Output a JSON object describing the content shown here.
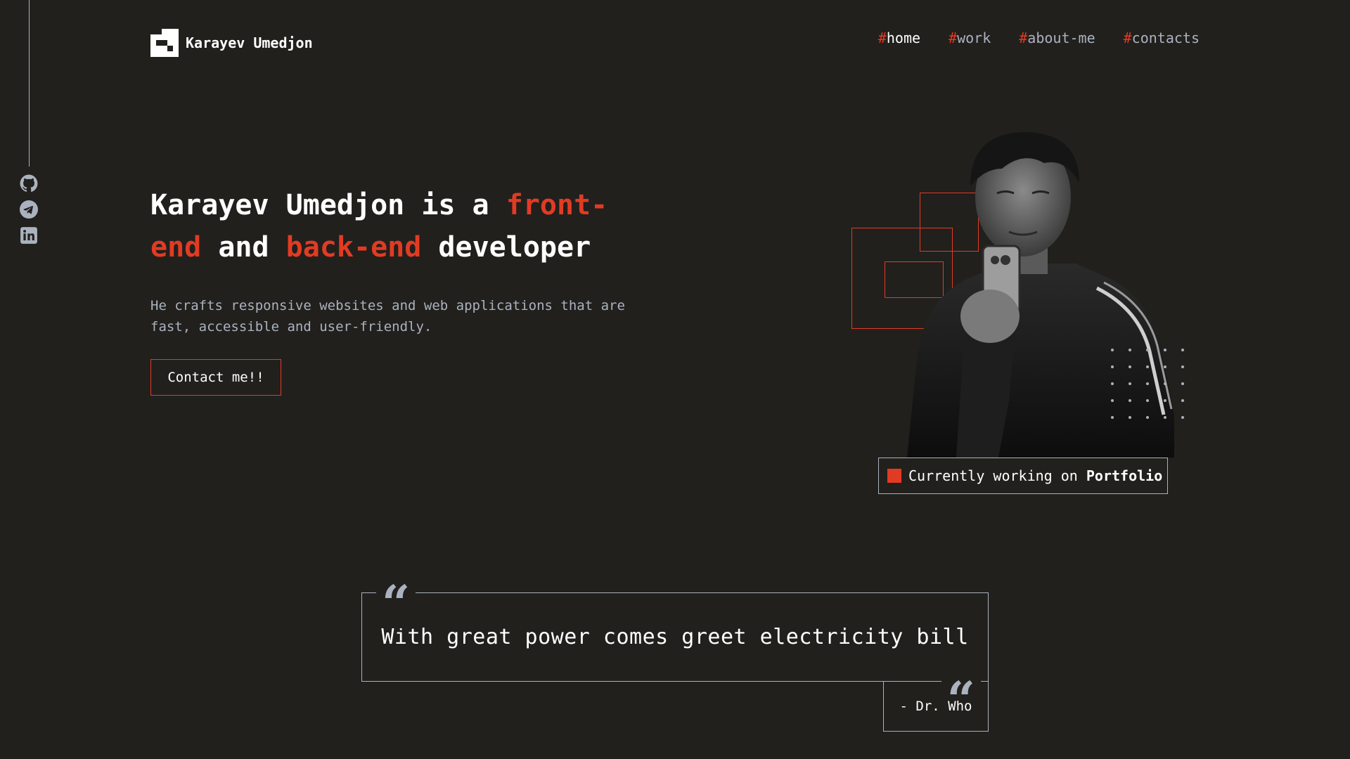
{
  "brand": {
    "name": "Karayev Umedjon",
    "logo_icon": "pixel-logo-icon"
  },
  "nav": {
    "items": [
      {
        "hash": "#",
        "label": "home",
        "active": true
      },
      {
        "hash": "#",
        "label": "work",
        "active": false
      },
      {
        "hash": "#",
        "label": "about-me",
        "active": false
      },
      {
        "hash": "#",
        "label": "contacts",
        "active": false
      }
    ]
  },
  "social": [
    {
      "icon": "github-icon"
    },
    {
      "icon": "telegram-icon"
    },
    {
      "icon": "linkedin-icon"
    }
  ],
  "hero": {
    "title_part1": "Karayev Umedjon is a ",
    "title_accent1": "front-end",
    "title_part2": " and ",
    "title_accent2": "back-end",
    "title_part3": " developer",
    "subtitle": "He crafts responsive websites and web applications that are fast, accessible and user-friendly.",
    "cta_label": "Contact me!!"
  },
  "status": {
    "prefix": "Currently working on ",
    "project": "Portfolio"
  },
  "quote": {
    "open_mark": "“",
    "close_mark": "“",
    "text": "With great power comes greet electricity bill",
    "author": "- Dr. Who"
  },
  "colors": {
    "background": "#21201d",
    "accent": "#e23b23",
    "muted": "#abb2bf",
    "text": "#ffffff"
  }
}
